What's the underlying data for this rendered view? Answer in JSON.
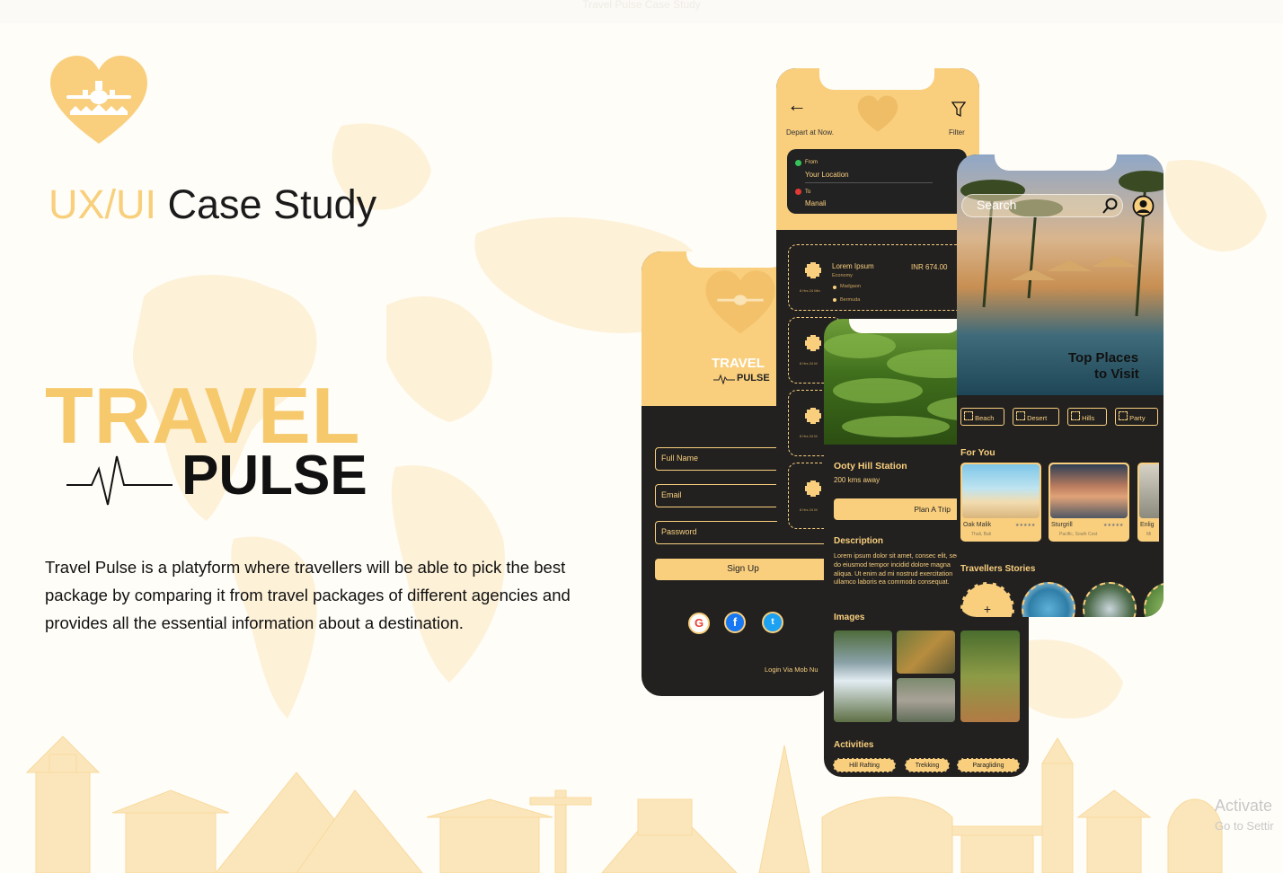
{
  "window": {
    "title": "Travel Pulse Case Study"
  },
  "hero": {
    "case_prefix": "UX/UI",
    "case_suffix": "Case Study",
    "brand_top": "TRAVEL",
    "brand_bottom": "PULSE",
    "description": "Travel Pulse is a platyform where travellers will be able to pick the best package by comparing it from travel packages of different agencies and provides all the essential information about a destination."
  },
  "colors": {
    "accent": "#f9cf7e",
    "dark": "#222120",
    "background": "#fffdf8"
  },
  "signup_screen": {
    "brand_top": "TRAVEL",
    "brand_bottom": "PULSE",
    "full_name_placeholder": "Full Name",
    "email_placeholder": "Email",
    "password_placeholder": "Password",
    "sign_up_label": "Sign Up",
    "social_icons": [
      "google-icon",
      "facebook-icon",
      "twitter-icon"
    ],
    "login_mobile_label": "Login Via Mob Nu"
  },
  "search_results_screen": {
    "depart_label": "Depart at Now.",
    "filter_label": "Filter",
    "from_label": "From",
    "from_value": "Your Location",
    "to_label": "To",
    "to_value": "Manali",
    "result": {
      "title": "Lorem Ipsum",
      "class": "Economy",
      "price": "INR 674.00",
      "stop1": "Madgaon",
      "stop2": "Bermuda",
      "duration": "8 Hrs 24 Min"
    },
    "duration_short": "8 Hrs 24 M"
  },
  "destination_screen": {
    "title": "Ooty Hill Station",
    "distance": "200 kms away",
    "plan_label": "Plan A Trip",
    "description_heading": "Description",
    "description_text": "Lorem ipsum dolor sit amet, consec elit, sed do eiusmod tempor incidid dolore magna aliqua. Ut enim ad mi nostrud exercitation ullamco laboris ea commodo consequat.",
    "images_heading": "Images",
    "activities_heading": "Activities",
    "activities": [
      "Hill Rafting",
      "Trekking",
      "Paragliding"
    ]
  },
  "home_screen": {
    "search_placeholder": "Search",
    "hero_line1": "Top Places",
    "hero_line2": "to Visit",
    "categories": [
      "Beach",
      "Desert",
      "Hills",
      "Party"
    ],
    "for_you_heading": "For You",
    "places": [
      {
        "name": "Oak Malik",
        "location": "Thali, Bali",
        "rating": "★★★★★"
      },
      {
        "name": "Sturgrill",
        "location": "Pacific, South Cost",
        "rating": "★★★★★"
      },
      {
        "name": "Enlig",
        "location": "Mi"
      }
    ],
    "stories_heading": "Travellers Stories",
    "add_story": "+"
  },
  "watermark": {
    "line1": "Activate",
    "line2": "Go to Settir"
  }
}
